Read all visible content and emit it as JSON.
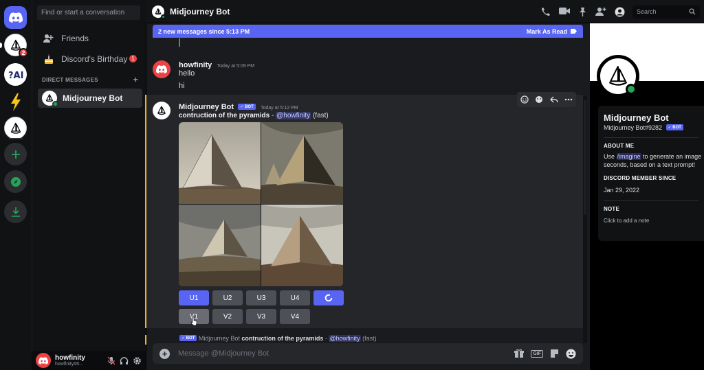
{
  "colors": {
    "blurple": "#5865f2",
    "green": "#23a55a",
    "red": "#ed4245",
    "yellow": "#f0b232"
  },
  "rail": {
    "badges": {
      "sailboat": "2"
    }
  },
  "dm_sidebar": {
    "search_placeholder": "Find or start a conversation",
    "friends_label": "Friends",
    "birthday_label": "Discord's Birthday",
    "birthday_badge": "1",
    "direct_messages_header": "DIRECT MESSAGES",
    "add_dm_symbol": "+",
    "dms": [
      {
        "name": "Midjourney Bot"
      }
    ]
  },
  "user_panel": {
    "username": "howfinity",
    "tag": "howfinity#6..."
  },
  "header": {
    "channel_title": "Midjourney Bot",
    "search_placeholder": "Search"
  },
  "new_messages_bar": {
    "text": "2 new messages since 5:13 PM",
    "action": "Mark As Read"
  },
  "messages": [
    {
      "author": "howfinity",
      "time": "Today at 5:09 PM",
      "lines": [
        "hello",
        "hi"
      ]
    },
    {
      "author": "Midjourney Bot",
      "bot_tag": "✓ BOT",
      "time": "Today at 5:12 PM",
      "prompt": "contruction of the pyramids",
      "prompt_sep": " - ",
      "mention": "@howfinity",
      "mode": " (fast)",
      "upscale_buttons": [
        "U1",
        "U2",
        "U3",
        "U4"
      ],
      "variation_buttons": [
        "V1",
        "V2",
        "V3",
        "V4"
      ]
    }
  ],
  "reply_preview": {
    "bot_tag": "✓ BOT",
    "author": "Midjourney Bot",
    "prompt": "contruction of the pyramids",
    "sep": " - ",
    "mention": "@howfinity",
    "mode": " (fast)"
  },
  "composer": {
    "placeholder": "Message @Midjourney Bot",
    "gif_label": "GIF"
  },
  "profile": {
    "name": "Midjourney Bot",
    "tag": "Midjourney Bot#9282",
    "bot_tag": "✓ BOT",
    "about_header": "ABOUT ME",
    "about_pre": "Use ",
    "about_cmd": "/imagine",
    "about_post": " to generate an image",
    "about_line2": "seconds, based on a text prompt!",
    "member_since_header": "DISCORD MEMBER SINCE",
    "member_since": "Jan 29, 2022",
    "note_header": "NOTE",
    "note_placeholder": "Click to add a note"
  }
}
